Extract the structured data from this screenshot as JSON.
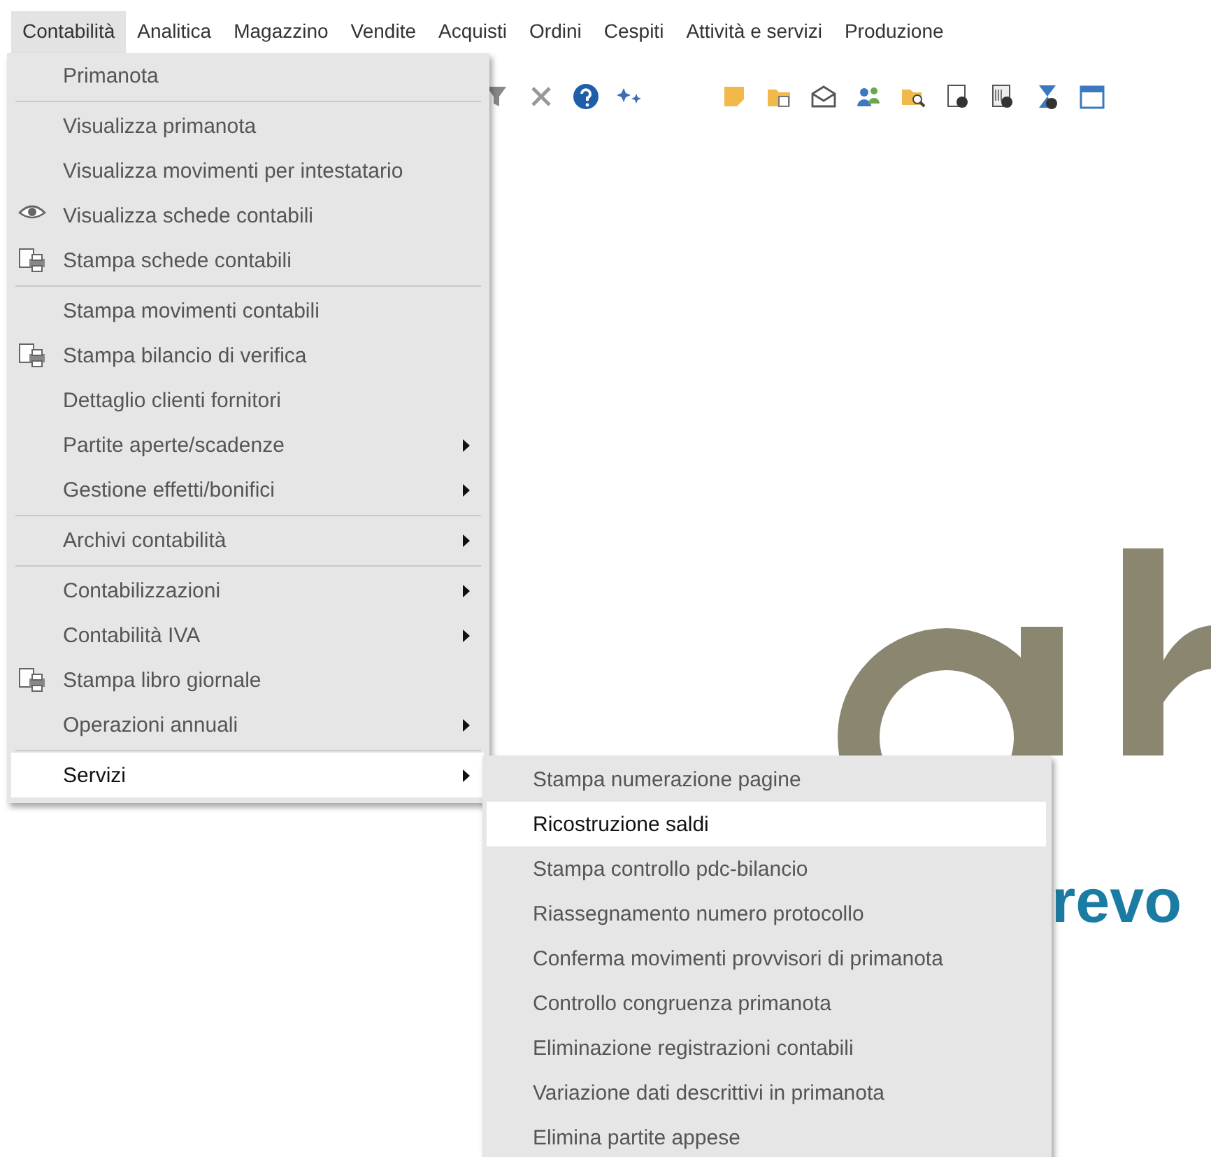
{
  "menubar": [
    {
      "label": "Contabilità",
      "selected": true
    },
    {
      "label": "Analitica",
      "selected": false
    },
    {
      "label": "Magazzino",
      "selected": false
    },
    {
      "label": "Vendite",
      "selected": false
    },
    {
      "label": "Acquisti",
      "selected": false
    },
    {
      "label": "Ordini",
      "selected": false
    },
    {
      "label": "Cespiti",
      "selected": false
    },
    {
      "label": "Attività e servizi",
      "selected": false
    },
    {
      "label": "Produzione",
      "selected": false
    }
  ],
  "menu": {
    "groups": [
      [
        {
          "label": "Primanota",
          "kind": "plain",
          "has_submenu": false,
          "selected": false
        }
      ],
      [
        {
          "label": "Visualizza primanota",
          "kind": "plain",
          "has_submenu": false,
          "selected": false
        },
        {
          "label": "Visualizza movimenti per intestatario",
          "kind": "plain",
          "has_submenu": false,
          "selected": false
        },
        {
          "label": "Visualizza schede contabili",
          "kind": "eye",
          "has_submenu": false,
          "selected": false
        },
        {
          "label": "Stampa schede contabili",
          "kind": "print",
          "has_submenu": false,
          "selected": false
        }
      ],
      [
        {
          "label": "Stampa movimenti contabili",
          "kind": "plain",
          "has_submenu": false,
          "selected": false
        },
        {
          "label": "Stampa bilancio di verifica",
          "kind": "print",
          "has_submenu": false,
          "selected": false
        },
        {
          "label": "Dettaglio clienti fornitori",
          "kind": "plain",
          "has_submenu": false,
          "selected": false
        },
        {
          "label": "Partite aperte/scadenze",
          "kind": "plain",
          "has_submenu": true,
          "selected": false
        },
        {
          "label": "Gestione effetti/bonifici",
          "kind": "plain",
          "has_submenu": true,
          "selected": false
        }
      ],
      [
        {
          "label": "Archivi contabilità",
          "kind": "plain",
          "has_submenu": true,
          "selected": false
        }
      ],
      [
        {
          "label": "Contabilizzazioni",
          "kind": "plain",
          "has_submenu": true,
          "selected": false
        },
        {
          "label": "Contabilità IVA",
          "kind": "plain",
          "has_submenu": true,
          "selected": false
        },
        {
          "label": "Stampa libro giornale",
          "kind": "print",
          "has_submenu": false,
          "selected": false
        },
        {
          "label": "Operazioni annuali",
          "kind": "plain",
          "has_submenu": true,
          "selected": false
        }
      ],
      [
        {
          "label": "Servizi",
          "kind": "plain",
          "has_submenu": true,
          "selected": true
        }
      ]
    ]
  },
  "submenu": {
    "items": [
      {
        "label": "Stampa numerazione pagine",
        "selected": false
      },
      {
        "label": "Ricostruzione saldi",
        "selected": true
      },
      {
        "label": "Stampa controllo pdc-bilancio",
        "selected": false
      },
      {
        "label": "Riassegnamento numero protocollo",
        "selected": false
      },
      {
        "label": "Conferma movimenti provvisori di primanota",
        "selected": false
      },
      {
        "label": "Controllo congruenza primanota",
        "selected": false
      },
      {
        "label": "Eliminazione registrazioni contabili",
        "selected": false
      },
      {
        "label": "Variazione dati descrittivi in primanota",
        "selected": false
      },
      {
        "label": "Elimina partite appese",
        "selected": false
      }
    ]
  },
  "logo": {
    "tagline": "revo"
  }
}
